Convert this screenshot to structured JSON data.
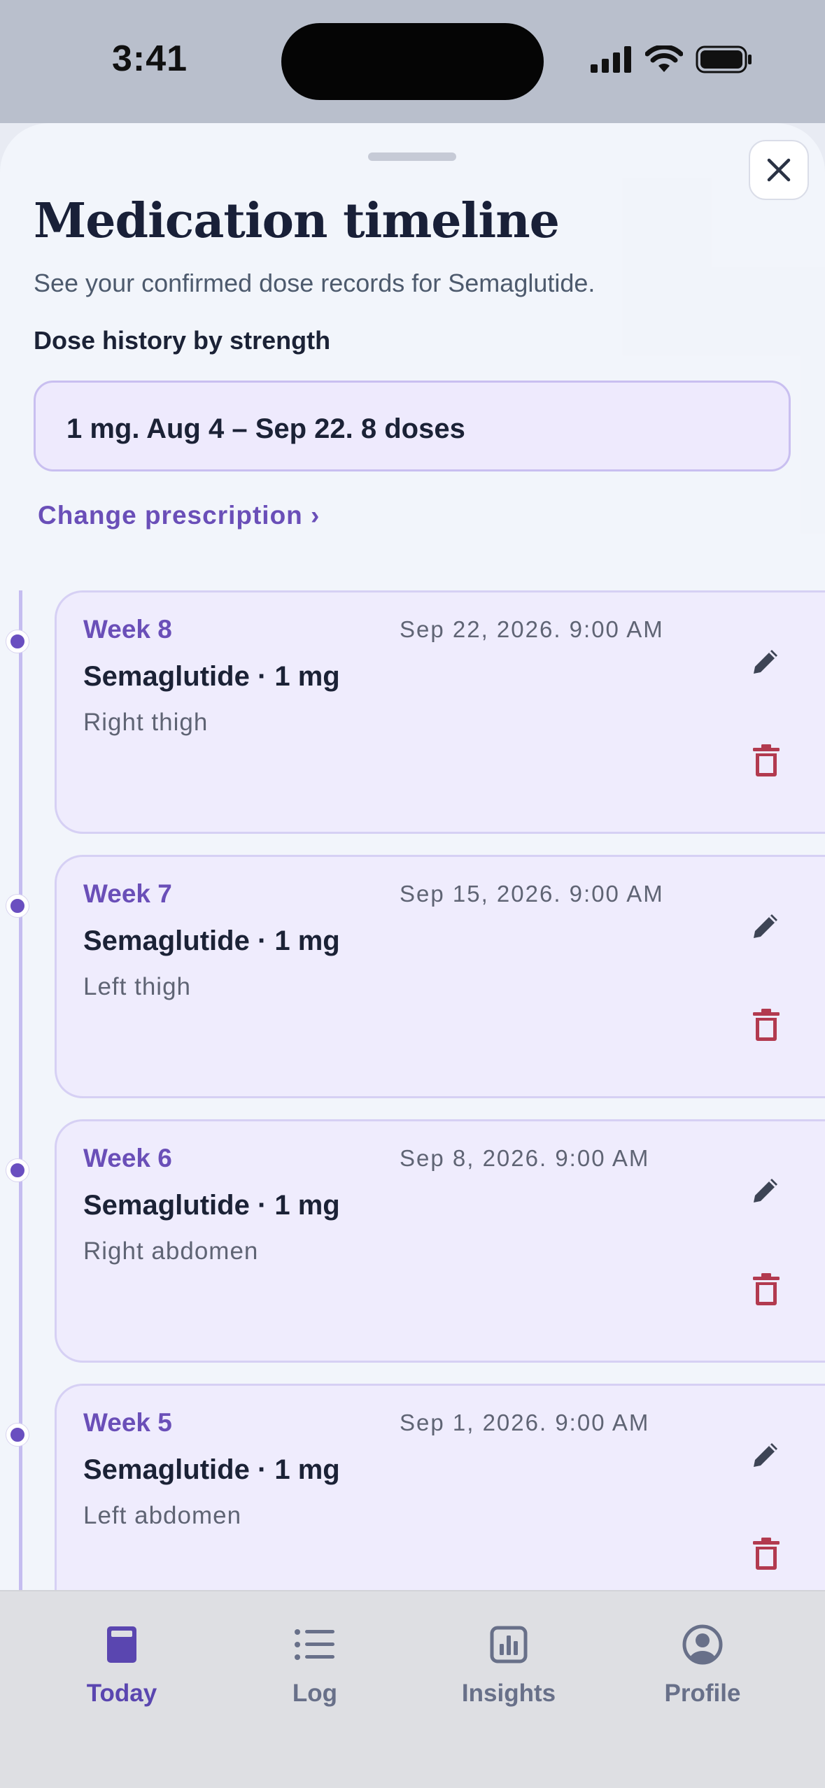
{
  "status_bar": {
    "time": "3:41"
  },
  "sheet": {
    "title": "Medication timeline",
    "subtitle": "See your confirmed dose records for Semaglutide.",
    "section_label": "Dose history by strength",
    "strength_summary": "1 mg. Aug 4 – Sep 22. 8 doses",
    "change_link": "Change prescription ›"
  },
  "doses": [
    {
      "week": "Week 8",
      "date": "Sep 22, 2026. 9:00 AM",
      "name": "Semaglutide · 1 mg",
      "site": "Right thigh"
    },
    {
      "week": "Week 7",
      "date": "Sep 15, 2026. 9:00 AM",
      "name": "Semaglutide · 1 mg",
      "site": "Left thigh"
    },
    {
      "week": "Week 6",
      "date": "Sep 8, 2026. 9:00 AM",
      "name": "Semaglutide · 1 mg",
      "site": "Right abdomen"
    },
    {
      "week": "Week 5",
      "date": "Sep 1, 2026. 9:00 AM",
      "name": "Semaglutide · 1 mg",
      "site": "Left abdomen"
    }
  ],
  "tab_bar": {
    "tabs": [
      {
        "label": "Today",
        "icon": "today-icon",
        "active": true
      },
      {
        "label": "Log",
        "icon": "list-icon",
        "active": false
      },
      {
        "label": "Insights",
        "icon": "bar-chart-icon",
        "active": false
      },
      {
        "label": "Profile",
        "icon": "profile-icon",
        "active": false
      }
    ]
  },
  "colors": {
    "accent": "#6a4fb8",
    "delete": "#b23a4f",
    "card_bg": "#efecfd"
  }
}
